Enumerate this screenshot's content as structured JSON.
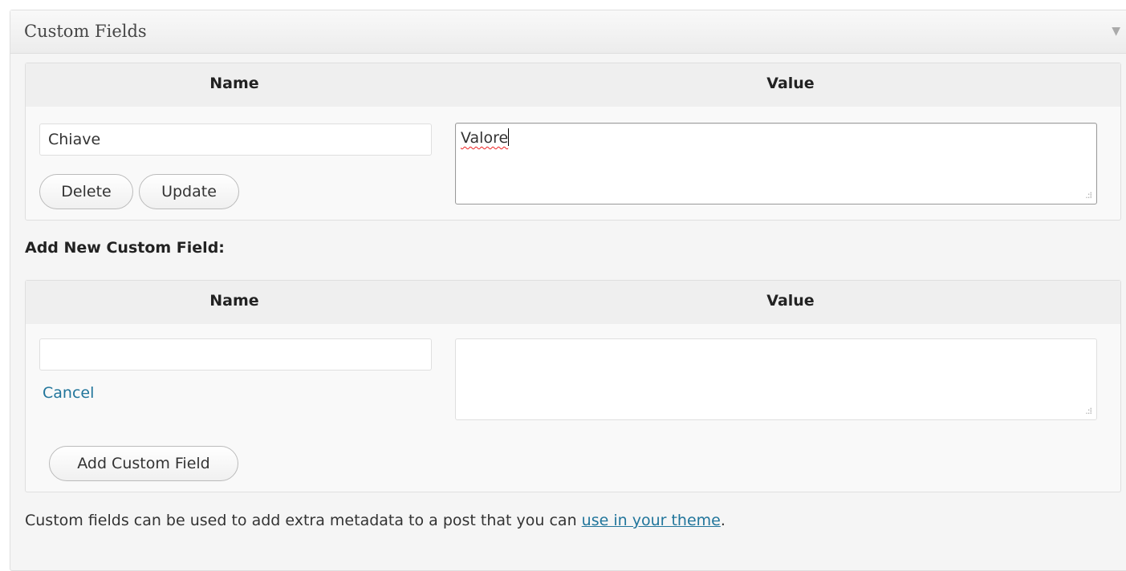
{
  "box": {
    "title": "Custom Fields",
    "toggle_icon": "triangle-down-icon",
    "toggle_glyph": "▼"
  },
  "existing": {
    "headers": {
      "name": "Name",
      "value": "Value"
    },
    "name_value": "Chiave",
    "value_text": "Valore",
    "delete_label": "Delete",
    "update_label": "Update"
  },
  "add_new": {
    "heading": "Add New Custom Field:",
    "headers": {
      "name": "Name",
      "value": "Value"
    },
    "name_value": "",
    "value_text": "",
    "cancel_label": "Cancel",
    "add_label": "Add Custom Field"
  },
  "footer": {
    "text_before": "Custom fields can be used to add extra metadata to a post that you can ",
    "link_label": "use in your theme",
    "text_after": "."
  },
  "colors": {
    "link": "#21759b",
    "panel_bg": "#f5f5f5",
    "header_bg": "#efefef",
    "border": "#dfdfdf"
  }
}
